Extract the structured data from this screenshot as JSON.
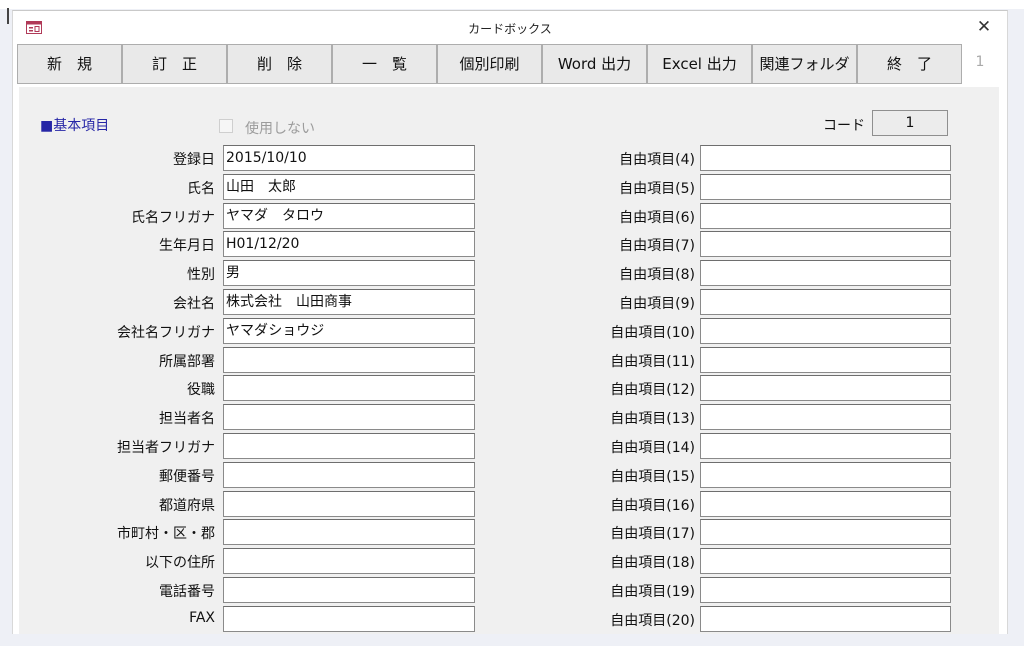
{
  "window": {
    "title": "カードボックス",
    "close_glyph": "✕",
    "app_icon": "form-icon"
  },
  "toolbar": {
    "buttons": [
      {
        "label": "新　規"
      },
      {
        "label": "訂　正"
      },
      {
        "label": "削　除"
      },
      {
        "label": "一　覧"
      },
      {
        "label": "個別印刷"
      },
      {
        "label": "Word 出力"
      },
      {
        "label": "Excel 出力"
      },
      {
        "label": "関連フォルダ"
      },
      {
        "label": "終　了"
      }
    ],
    "page_number": "1"
  },
  "form": {
    "section_title": "■基本項目",
    "unused_checkbox_label": "使用しない",
    "unused_checked": false,
    "code_label": "コード",
    "code_value": "1",
    "left_fields": [
      {
        "label": "登録日",
        "value": "2015/10/10"
      },
      {
        "label": "氏名",
        "value": "山田　太郎"
      },
      {
        "label": "氏名フリガナ",
        "value": "ヤマダ　タロウ"
      },
      {
        "label": "生年月日",
        "value": "H01/12/20"
      },
      {
        "label": "性別",
        "value": "男"
      },
      {
        "label": "会社名",
        "value": "株式会社　山田商事"
      },
      {
        "label": "会社名フリガナ",
        "value": "ヤマダショウジ"
      },
      {
        "label": "所属部署",
        "value": ""
      },
      {
        "label": "役職",
        "value": ""
      },
      {
        "label": "担当者名",
        "value": ""
      },
      {
        "label": "担当者フリガナ",
        "value": ""
      },
      {
        "label": "郵便番号",
        "value": ""
      },
      {
        "label": "都道府県",
        "value": ""
      },
      {
        "label": "市町村・区・郡",
        "value": ""
      },
      {
        "label": "以下の住所",
        "value": ""
      },
      {
        "label": "電話番号",
        "value": ""
      },
      {
        "label": "FAX",
        "value": ""
      }
    ],
    "right_fields": [
      {
        "label": "自由項目(4)",
        "value": ""
      },
      {
        "label": "自由項目(5)",
        "value": ""
      },
      {
        "label": "自由項目(6)",
        "value": ""
      },
      {
        "label": "自由項目(7)",
        "value": ""
      },
      {
        "label": "自由項目(8)",
        "value": ""
      },
      {
        "label": "自由項目(9)",
        "value": ""
      },
      {
        "label": "自由項目(10)",
        "value": ""
      },
      {
        "label": "自由項目(11)",
        "value": ""
      },
      {
        "label": "自由項目(12)",
        "value": ""
      },
      {
        "label": "自由項目(13)",
        "value": ""
      },
      {
        "label": "自由項目(14)",
        "value": ""
      },
      {
        "label": "自由項目(15)",
        "value": ""
      },
      {
        "label": "自由項目(16)",
        "value": ""
      },
      {
        "label": "自由項目(17)",
        "value": ""
      },
      {
        "label": "自由項目(18)",
        "value": ""
      },
      {
        "label": "自由項目(19)",
        "value": ""
      },
      {
        "label": "自由項目(20)",
        "value": ""
      }
    ]
  },
  "colors": {
    "section_title": "#2626a6",
    "form_bg": "#f0f0f0",
    "button_bg": "#e9e9e9",
    "disabled_text": "#9c9c9c"
  }
}
